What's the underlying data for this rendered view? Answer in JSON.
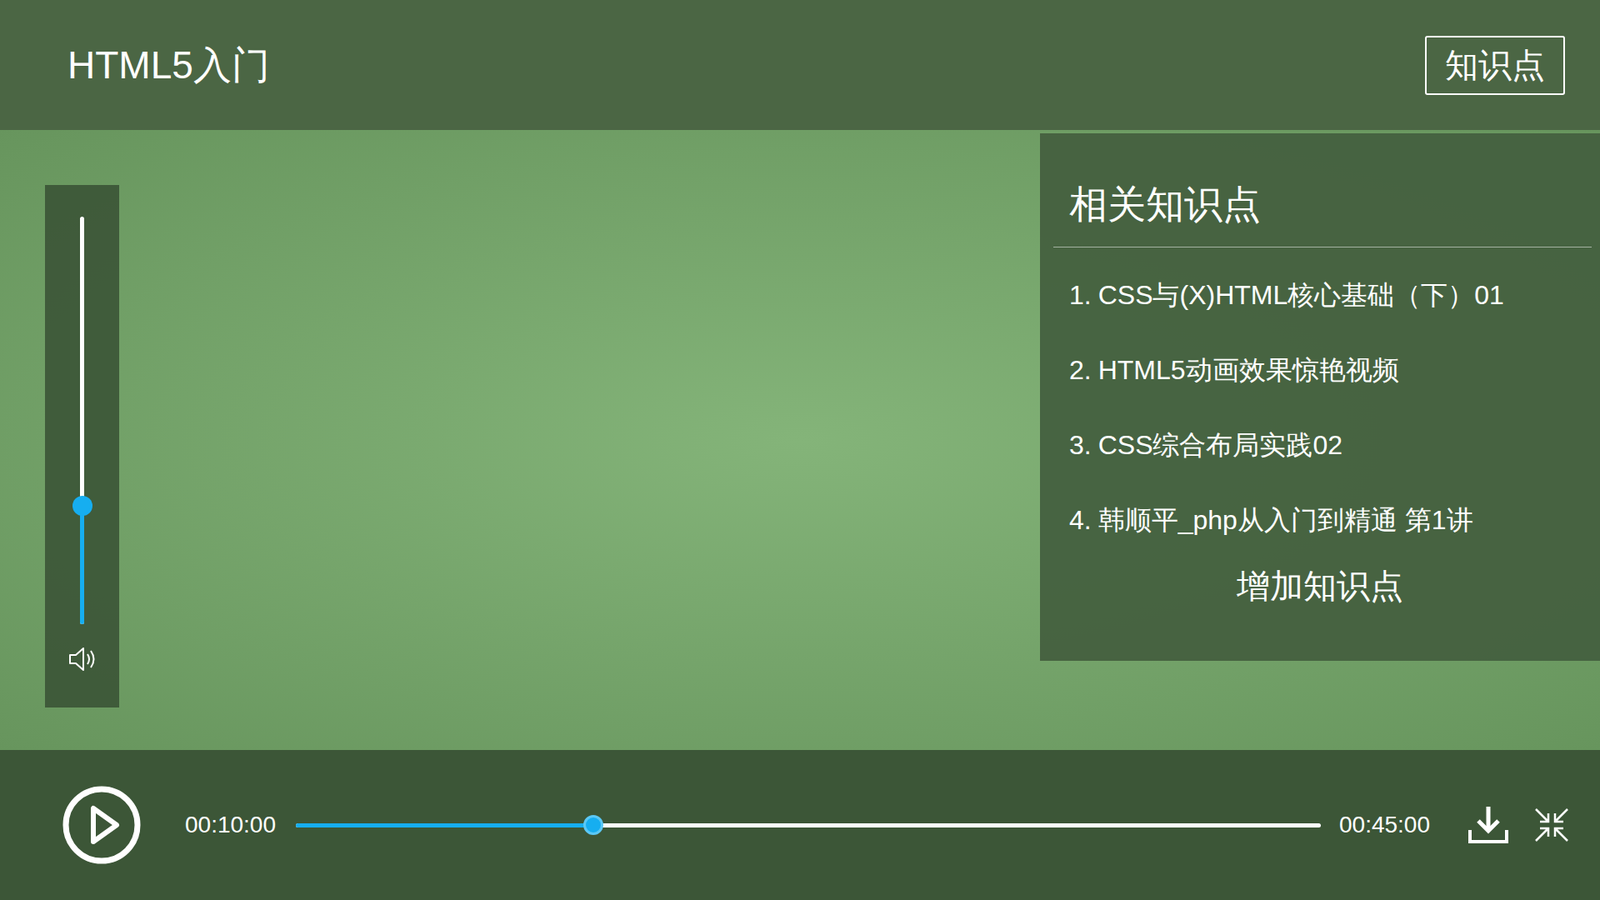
{
  "window": {
    "title": "HTML5入门"
  },
  "header_button": {
    "label": "知识点"
  },
  "volume": {
    "level": 0.29
  },
  "knowledge_panel": {
    "title": "相关知识点",
    "items": [
      {
        "number": "1.",
        "label": "CSS与(X)HTML核心基础（下）01"
      },
      {
        "number": "2.",
        "label": "HTML5动画效果惊艳视频"
      },
      {
        "number": "3.",
        "label": "CSS综合布局实践02"
      },
      {
        "number": "4.",
        "label": "韩顺平_php从入门到精通 第1讲"
      }
    ],
    "add_button": "增加知识点"
  },
  "player": {
    "playing": false,
    "current_time": "00:10:00",
    "duration": "00:45:00",
    "progress": 0.29
  }
}
